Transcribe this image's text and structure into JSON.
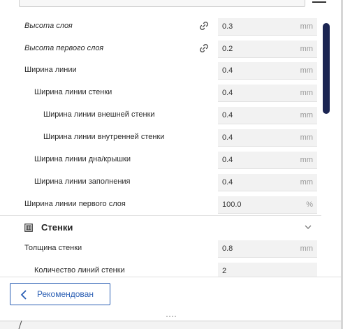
{
  "accent_color": "#2b5fb4",
  "scrollbar_color": "#1b2552",
  "settings": [
    {
      "label": "Высота слоя",
      "value": "0.3",
      "unit": "mm",
      "italic": true,
      "linked": true
    },
    {
      "label": "Высота первого слоя",
      "value": "0.2",
      "unit": "mm",
      "italic": true,
      "linked": true
    },
    {
      "label": "Ширина линии",
      "value": "0.4",
      "unit": "mm"
    },
    {
      "label": "Ширина линии стенки",
      "value": "0.4",
      "unit": "mm"
    },
    {
      "label": "Ширина линии внешней стенки",
      "value": "0.4",
      "unit": "mm"
    },
    {
      "label": "Ширина линии внутренней стенки",
      "value": "0.4",
      "unit": "mm"
    },
    {
      "label": "Ширина линии дна/крышки",
      "value": "0.4",
      "unit": "mm"
    },
    {
      "label": "Ширина линии заполнения",
      "value": "0.4",
      "unit": "mm"
    },
    {
      "label": "Ширина линии первого слоя",
      "value": "100.0",
      "unit": "%"
    }
  ],
  "section": {
    "title": "Стенки",
    "icon": "walls-icon"
  },
  "wall_settings": [
    {
      "label": "Толщина стенки",
      "value": "0.8",
      "unit": "mm"
    },
    {
      "label": "Количество линий стенки",
      "value": "2",
      "unit": ""
    }
  ],
  "footer": {
    "recommended_label": "Рекомендован"
  }
}
